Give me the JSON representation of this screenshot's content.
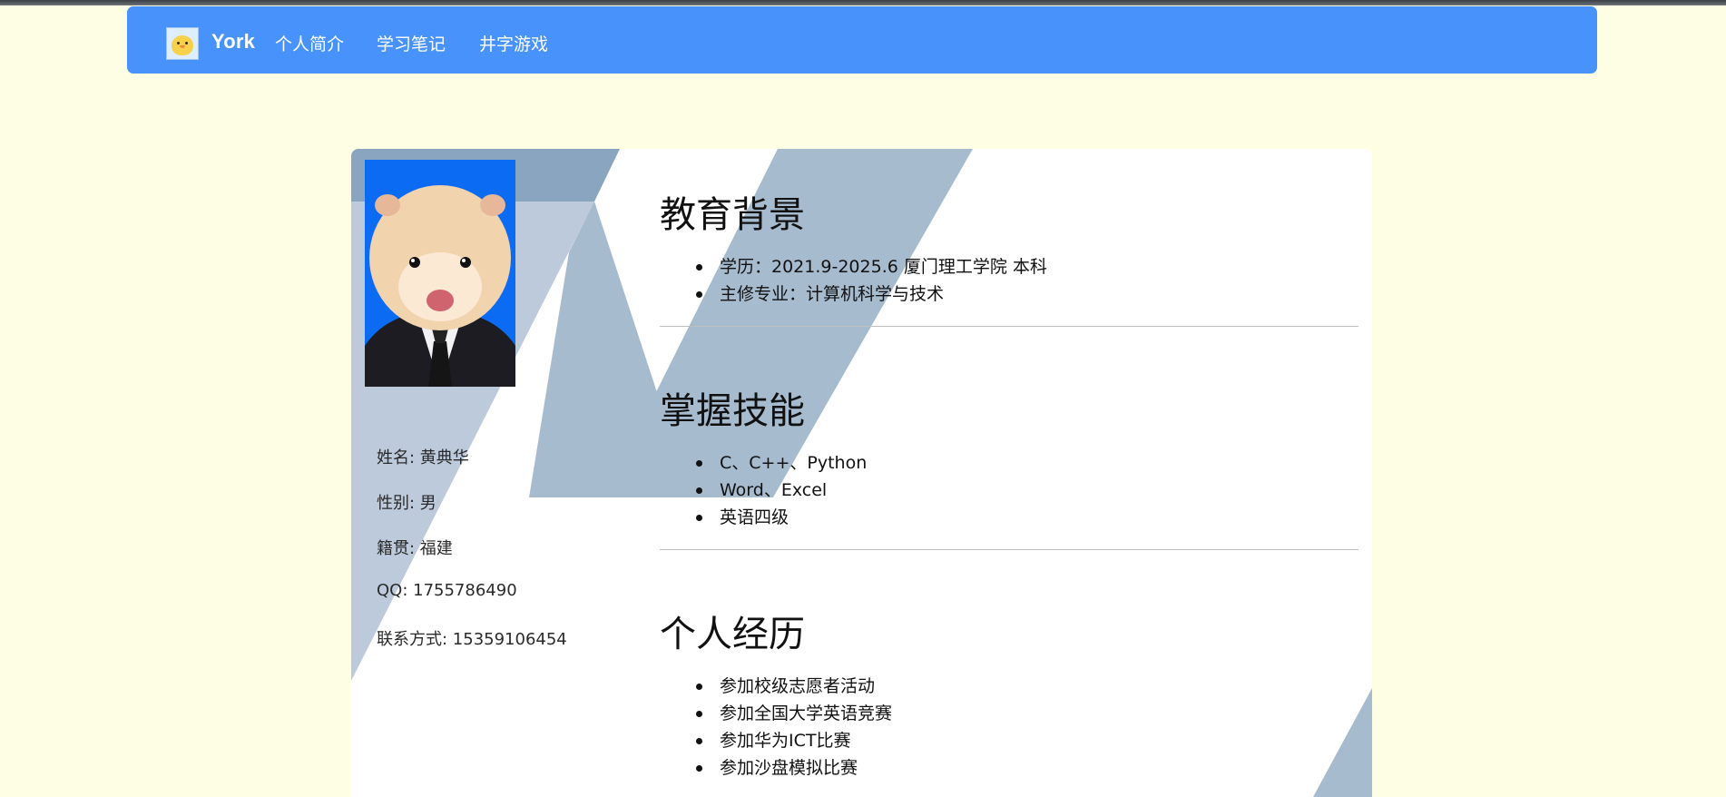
{
  "nav": {
    "brand_name": "York",
    "links": [
      "个人简介",
      "学习笔记",
      "井字游戏"
    ]
  },
  "profile": {
    "name_label": "姓名: 黄典华",
    "gender_label": "性别: 男",
    "hometown_label": "籍贯: 福建",
    "qq_label": "QQ: 1755786490",
    "phone_label": "联系方式: 15359106454"
  },
  "sections": {
    "education": {
      "title": "教育背景",
      "items": [
        "学历：2021.9-2025.6 厦门理工学院 本科",
        "主修专业：计算机科学与技术"
      ]
    },
    "skills": {
      "title": "掌握技能",
      "items": [
        "C、C++、Python",
        "Word、Excel",
        "英语四级"
      ]
    },
    "experience": {
      "title": "个人经历",
      "items": [
        "参加校级志愿者活动",
        "参加全国大学英语竞赛",
        "参加华为ICT比赛",
        "参加沙盘模拟比赛"
      ]
    }
  },
  "colors": {
    "page_bg": "#fdfee4",
    "navbar": "#4792fb",
    "card_bg": "#ffffff",
    "stripe_dark": "#8aa5bf",
    "stripe_mid": "#a7bbcf",
    "stripe_light": "#bccadb"
  }
}
